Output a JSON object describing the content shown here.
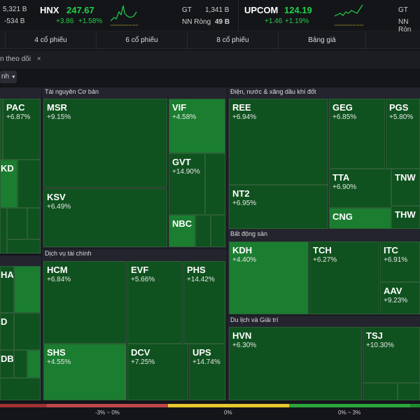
{
  "header": {
    "left": {
      "gt": "5,321 B",
      "nn": "-534 B"
    },
    "hnx": {
      "name": "HNX",
      "value": "247.67",
      "change": "+3.86",
      "pct": "+1.58%",
      "gt_label": "GT",
      "gt": "1,341 B",
      "nn_label": "NN Ròng",
      "nn": "49 B"
    },
    "upcom": {
      "name": "UPCOM",
      "value": "124.19",
      "change": "+1.46",
      "pct": "+1.19%",
      "gt_label": "GT",
      "nn_label": "NN Ròn"
    }
  },
  "tabs": [
    "4 cổ phiếu",
    "6 cổ phiếu",
    "8 cổ phiếu",
    "Bảng giá"
  ],
  "filter": {
    "label": "n theo dõi",
    "close": "×",
    "dropdown": "nh"
  },
  "sectors": {
    "tainguyen": {
      "title": "Tài nguyên Cơ bản",
      "tiles": [
        {
          "s": "MSR",
          "p": "+9.15%"
        },
        {
          "s": "KSV",
          "p": "+6.49%"
        },
        {
          "s": "VIF",
          "p": "+4.58%"
        },
        {
          "s": "GVT",
          "p": "+14.90%"
        },
        {
          "s": "NBC",
          "p": ""
        }
      ]
    },
    "dichvu": {
      "title": "Dịch vụ tài chính",
      "tiles": [
        {
          "s": "HCM",
          "p": "+6.84%"
        },
        {
          "s": "EVF",
          "p": "+5.66%"
        },
        {
          "s": "PHS",
          "p": "+14.42%"
        },
        {
          "s": "SHS",
          "p": "+4.55%"
        },
        {
          "s": "DCV",
          "p": "+7.25%"
        },
        {
          "s": "UPS",
          "p": "+14.74%"
        }
      ]
    },
    "dien": {
      "title": "Điện, nước & xăng dầu khí đốt",
      "tiles": [
        {
          "s": "REE",
          "p": "+6.94%"
        },
        {
          "s": "NT2",
          "p": "+6.95%"
        },
        {
          "s": "GEG",
          "p": "+6.85%"
        },
        {
          "s": "PGS",
          "p": "+5.80%"
        },
        {
          "s": "TTA",
          "p": "+6.90%"
        },
        {
          "s": "TNW",
          "p": ""
        },
        {
          "s": "CNG",
          "p": ""
        },
        {
          "s": "THW",
          "p": ""
        }
      ]
    },
    "bds": {
      "title": "Bất động sản",
      "tiles": [
        {
          "s": "KDH",
          "p": "+4.40%"
        },
        {
          "s": "TCH",
          "p": "+6.27%"
        },
        {
          "s": "ITC",
          "p": "+6.91%"
        },
        {
          "s": "AAV",
          "p": "+9.23%"
        }
      ]
    },
    "dulich": {
      "title": "Du lịch và Giải trí",
      "tiles": [
        {
          "s": "HVN",
          "p": "+6.30%"
        },
        {
          "s": "TSJ",
          "p": "+10.30%"
        }
      ]
    },
    "left1": {
      "tiles": [
        {
          "s": "PAC",
          "p": "+6.87%"
        },
        {
          "s": "KD",
          "p": ""
        }
      ]
    },
    "left2": {
      "tiles": [
        {
          "s": "HA",
          "p": ""
        },
        {
          "s": "D",
          "p": ""
        },
        {
          "s": "DB",
          "p": ""
        }
      ]
    }
  },
  "legend": [
    "-3% ~ 0%",
    "0%",
    "0% ~ 3%"
  ],
  "colors": {
    "up": "#1fd14a",
    "tile_dark": "#10521f",
    "tile_light": "#1b7d30",
    "red": "#c0474a",
    "yellow": "#e8c82e",
    "green": "#2aa63c"
  }
}
